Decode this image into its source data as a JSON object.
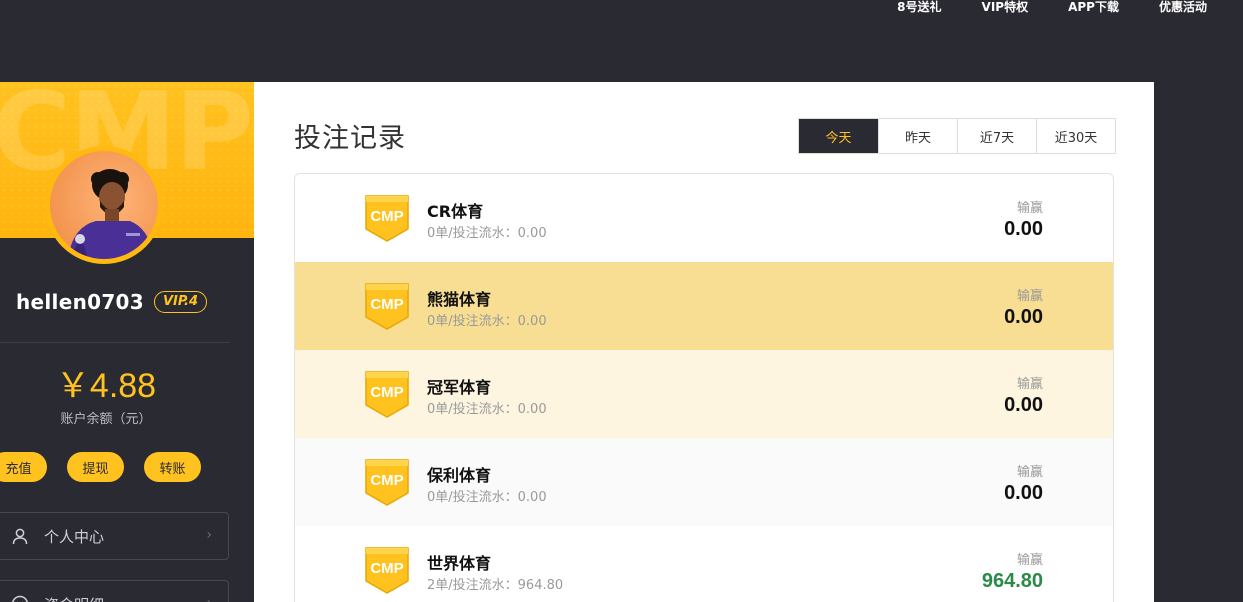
{
  "topnav": [
    "8号送礼",
    "VIP特权",
    "APP下载",
    "优惠活动"
  ],
  "sidebar": {
    "banner_watermark": "CMP",
    "username": "hellen0703",
    "vip": "VIP.4",
    "balance": "￥4.88",
    "balance_label": "账户余额（元）",
    "actions": [
      "充值",
      "提现",
      "转账"
    ],
    "menu": [
      {
        "label": "个人中心",
        "icon": "user-icon"
      },
      {
        "label": "资金明细",
        "icon": "coin-icon"
      }
    ]
  },
  "main": {
    "title": "投注记录",
    "date_tabs": [
      "今天",
      "昨天",
      "近7天",
      "近30天"
    ],
    "active_tab": 0,
    "win_loss_label": "输赢",
    "records": [
      {
        "name": "CR体育",
        "sub": "0单/投注流水：0.00",
        "value": "0.00",
        "bg": "#ffffff",
        "positive": false
      },
      {
        "name": "熊猫体育",
        "sub": "0单/投注流水：0.00",
        "value": "0.00",
        "bg": "#f7de93",
        "positive": false
      },
      {
        "name": "冠军体育",
        "sub": "0单/投注流水：0.00",
        "value": "0.00",
        "bg": "#fdf5e0",
        "positive": false
      },
      {
        "name": "保利体育",
        "sub": "0单/投注流水：0.00",
        "value": "0.00",
        "bg": "#fafafa",
        "positive": false
      },
      {
        "name": "世界体育",
        "sub": "2单/投注流水：964.80",
        "value": "964.80",
        "bg": "#ffffff",
        "positive": true
      }
    ],
    "logo_text": "CMP"
  },
  "colors": {
    "accent": "#ffc21f",
    "dark": "#2a2a33",
    "positive": "#2a8a48"
  }
}
